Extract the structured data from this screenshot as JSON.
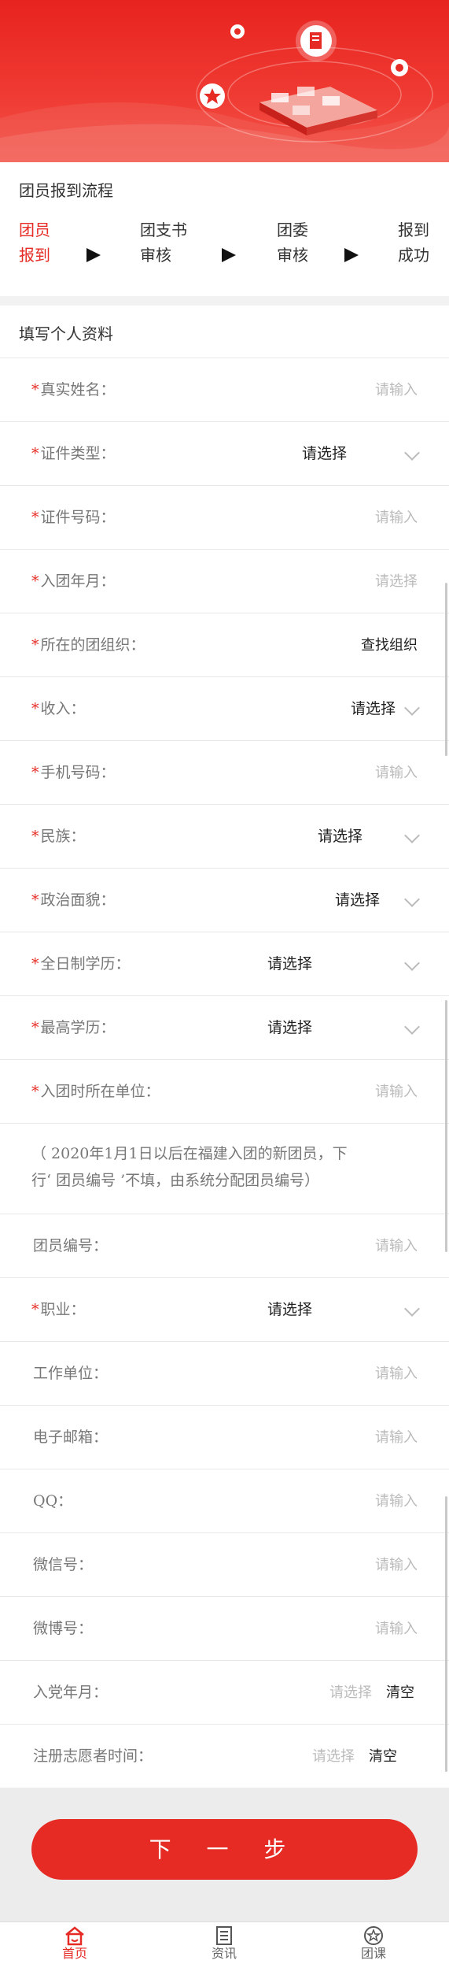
{
  "process": {
    "title": "团员报到流程",
    "steps": [
      {
        "line1": "团员",
        "line2": "报到"
      },
      {
        "line1": "团支书",
        "line2": "审核"
      },
      {
        "line1": "团委",
        "line2": "审核"
      },
      {
        "line1": "报到",
        "line2": "成功"
      }
    ]
  },
  "form": {
    "title": "填写个人资料",
    "rows": [
      {
        "label": "真实姓名：",
        "required": "*",
        "value": "请输入"
      },
      {
        "label": "证件类型：",
        "required": "*",
        "value": "请选择"
      },
      {
        "label": "证件号码：",
        "required": "*",
        "value": "请输入"
      },
      {
        "label": "入团年月：",
        "required": "*",
        "value": "请选择"
      },
      {
        "label": "所在的团组织：",
        "required": "*",
        "value": "查找组织"
      },
      {
        "label": "收入：",
        "required": "*",
        "value": "请选择"
      },
      {
        "label": "手机号码：",
        "required": "*",
        "value": "请输入"
      },
      {
        "label": "民族：",
        "required": "*",
        "value": "请选择"
      },
      {
        "label": "政治面貌：",
        "required": "*",
        "value": "请选择"
      },
      {
        "label": "全日制学历：",
        "required": "*",
        "value": "请选择"
      },
      {
        "label": "最高学历：",
        "required": "*",
        "value": "请选择"
      },
      {
        "label": "入团时所在单位：",
        "required": "*",
        "value": "请输入"
      },
      {
        "label": "团员编号：",
        "required": "",
        "value": "请输入"
      },
      {
        "label": "职业：",
        "required": "*",
        "value": "请选择"
      },
      {
        "label": "工作单位：",
        "required": "",
        "value": "请输入"
      },
      {
        "label": "电子邮箱：",
        "required": "",
        "value": "请输入"
      },
      {
        "label": "QQ：",
        "required": "",
        "value": "请输入"
      },
      {
        "label": "微信号：",
        "required": "",
        "value": "请输入"
      },
      {
        "label": "微博号：",
        "required": "",
        "value": "请输入"
      },
      {
        "label": "入党年月：",
        "required": "",
        "value": "请选择",
        "clear": "清空"
      },
      {
        "label": "注册志愿者时间：",
        "required": "",
        "value": "请选择",
        "clear": "清空"
      }
    ],
    "note_line1": "（ 2020年1月1日以后在福建入团的新团员，下",
    "note_line2": "行‘ 团员编号 ’不填，由系统分配团员编号）"
  },
  "next_button": "下 一 步",
  "tabbar": {
    "items": [
      {
        "label": "首页",
        "icon": "home-icon"
      },
      {
        "label": "资讯",
        "icon": "news-icon"
      },
      {
        "label": "团课",
        "icon": "lesson-icon"
      }
    ]
  },
  "colors": {
    "accent": "#e52b24",
    "banner": "#ea2a22"
  }
}
